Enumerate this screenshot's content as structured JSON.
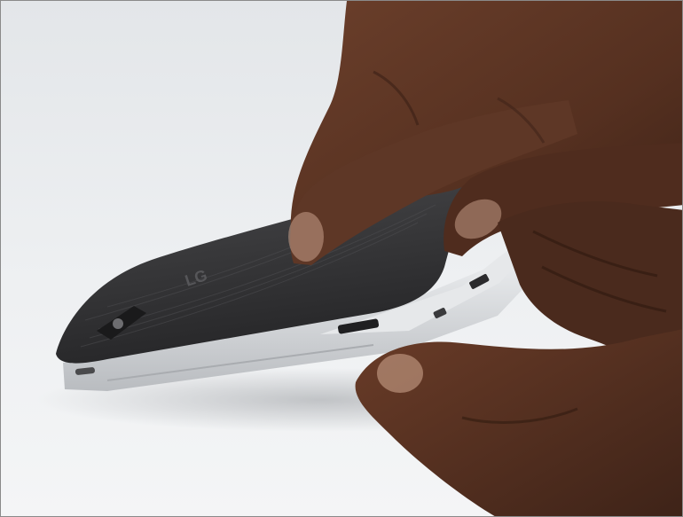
{
  "photo": {
    "subject": "phone-back-cover-removal",
    "colors": {
      "background": "#eceef0",
      "skin": "#5a3424",
      "skin_shadow": "#3a2016",
      "cover": "#3c3c3e",
      "frame": "#d9dcdf"
    },
    "cover_logo_text": "LG"
  }
}
